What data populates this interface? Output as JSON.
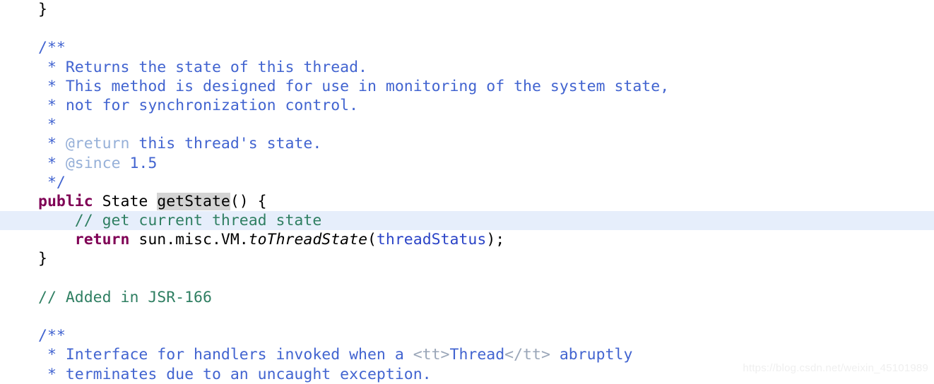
{
  "editor": {
    "language": "Java",
    "background_color": "#ffffff",
    "highlight_line_color": "#e6eefb",
    "occurrence_highlight_color": "#d4d4d4",
    "colors": {
      "plain": "#000000",
      "line_comment": "#2f7f62",
      "javadoc_body": "#4264d0",
      "javadoc_tag": "#96b0d8",
      "javadoc_html_tag": "#9aa6b8",
      "keyword": "#7f0055",
      "field": "#2b44c7"
    }
  },
  "watermark": {
    "text": "https://blog.csdn.net/weixin_45101989"
  },
  "code": {
    "lines": [
      {
        "id": 1,
        "highlighted": false,
        "text": "}"
      },
      {
        "id": 2,
        "highlighted": false,
        "text": ""
      },
      {
        "id": 3,
        "highlighted": false,
        "text": "/**"
      },
      {
        "id": 4,
        "highlighted": false,
        "text": " * Returns the state of this thread."
      },
      {
        "id": 5,
        "highlighted": false,
        "text": " * This method is designed for use in monitoring of the system state,"
      },
      {
        "id": 6,
        "highlighted": false,
        "text": " * not for synchronization control."
      },
      {
        "id": 7,
        "highlighted": false,
        "text": " *"
      },
      {
        "id": 8,
        "highlighted": false,
        "text": " * @return this thread's state."
      },
      {
        "id": 9,
        "highlighted": false,
        "text": " * @since 1.5"
      },
      {
        "id": 10,
        "highlighted": false,
        "text": " */"
      },
      {
        "id": 11,
        "highlighted": false,
        "text": "public State getState() {"
      },
      {
        "id": 12,
        "highlighted": true,
        "text": "    // get current thread state"
      },
      {
        "id": 13,
        "highlighted": false,
        "text": "    return sun.misc.VM.toThreadState(threadStatus);"
      },
      {
        "id": 14,
        "highlighted": false,
        "text": "}"
      },
      {
        "id": 15,
        "highlighted": false,
        "text": ""
      },
      {
        "id": 16,
        "highlighted": false,
        "text": "// Added in JSR-166"
      },
      {
        "id": 17,
        "highlighted": false,
        "text": ""
      },
      {
        "id": 18,
        "highlighted": false,
        "text": "/**"
      },
      {
        "id": 19,
        "highlighted": false,
        "text": " * Interface for handlers invoked when a <tt>Thread</tt> abruptly"
      },
      {
        "id": 20,
        "highlighted": false,
        "text": " * terminates due to an uncaught exception."
      }
    ],
    "tokens": {
      "line1": [
        {
          "t": "}",
          "c": "plain"
        }
      ],
      "line3": [
        {
          "t": "/**",
          "c": "doc"
        }
      ],
      "line4": [
        {
          "t": " * Returns the state of this thread.",
          "c": "doc"
        }
      ],
      "line5": [
        {
          "t": " * This method is designed for use in monitoring of the system state,",
          "c": "doc"
        }
      ],
      "line6": [
        {
          "t": " * not for synchronization control.",
          "c": "doc"
        }
      ],
      "line7": [
        {
          "t": " *",
          "c": "doc"
        }
      ],
      "line8": [
        {
          "t": " * ",
          "c": "doc"
        },
        {
          "t": "@return",
          "c": "doctag"
        },
        {
          "t": " this thread's state.",
          "c": "doc"
        }
      ],
      "line9": [
        {
          "t": " * ",
          "c": "doc"
        },
        {
          "t": "@since",
          "c": "doctag"
        },
        {
          "t": " 1.5",
          "c": "doc"
        }
      ],
      "line10": [
        {
          "t": " */",
          "c": "doc"
        }
      ],
      "line11": [
        {
          "t": "public",
          "c": "keyword"
        },
        {
          "t": " State ",
          "c": "plain"
        },
        {
          "t": "getState",
          "c": "plain-selected"
        },
        {
          "t": "() {",
          "c": "plain"
        }
      ],
      "line12": [
        {
          "t": "    // get current thread state",
          "c": "comment"
        }
      ],
      "line13": [
        {
          "t": "    ",
          "c": "plain"
        },
        {
          "t": "return",
          "c": "keyword"
        },
        {
          "t": " sun.misc.VM.",
          "c": "plain"
        },
        {
          "t": "toThreadState",
          "c": "italic"
        },
        {
          "t": "(",
          "c": "plain"
        },
        {
          "t": "threadStatus",
          "c": "field"
        },
        {
          "t": ");",
          "c": "plain"
        }
      ],
      "line14": [
        {
          "t": "}",
          "c": "plain"
        }
      ],
      "line16": [
        {
          "t": "// Added in JSR-166",
          "c": "comment"
        }
      ],
      "line18": [
        {
          "t": "/**",
          "c": "doc"
        }
      ],
      "line19": [
        {
          "t": " * Interface for handlers invoked when a ",
          "c": "doc"
        },
        {
          "t": "<tt>",
          "c": "dochtml"
        },
        {
          "t": "Thread",
          "c": "doc"
        },
        {
          "t": "</tt>",
          "c": "dochtml"
        },
        {
          "t": " abruptly",
          "c": "doc"
        }
      ],
      "line20": [
        {
          "t": " * terminates due to an uncaught exception.",
          "c": "doc"
        }
      ]
    }
  }
}
